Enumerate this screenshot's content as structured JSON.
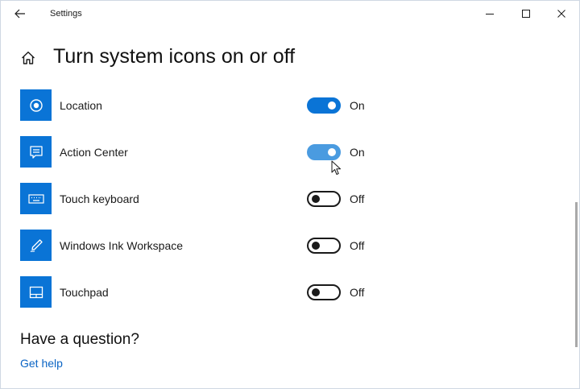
{
  "window": {
    "title": "Settings"
  },
  "page": {
    "title": "Turn system icons on or off"
  },
  "colors": {
    "accent": "#0a74d6",
    "link": "#0a64c4"
  },
  "items": [
    {
      "label": "Location",
      "state": "On",
      "on": true,
      "icon": "location-icon"
    },
    {
      "label": "Action Center",
      "state": "On",
      "on": true,
      "icon": "action-center-icon"
    },
    {
      "label": "Touch keyboard",
      "state": "Off",
      "on": false,
      "icon": "keyboard-icon"
    },
    {
      "label": "Windows Ink Workspace",
      "state": "Off",
      "on": false,
      "icon": "pen-icon"
    },
    {
      "label": "Touchpad",
      "state": "Off",
      "on": false,
      "icon": "touchpad-icon"
    }
  ],
  "help": {
    "heading": "Have a question?",
    "link": "Get help"
  }
}
